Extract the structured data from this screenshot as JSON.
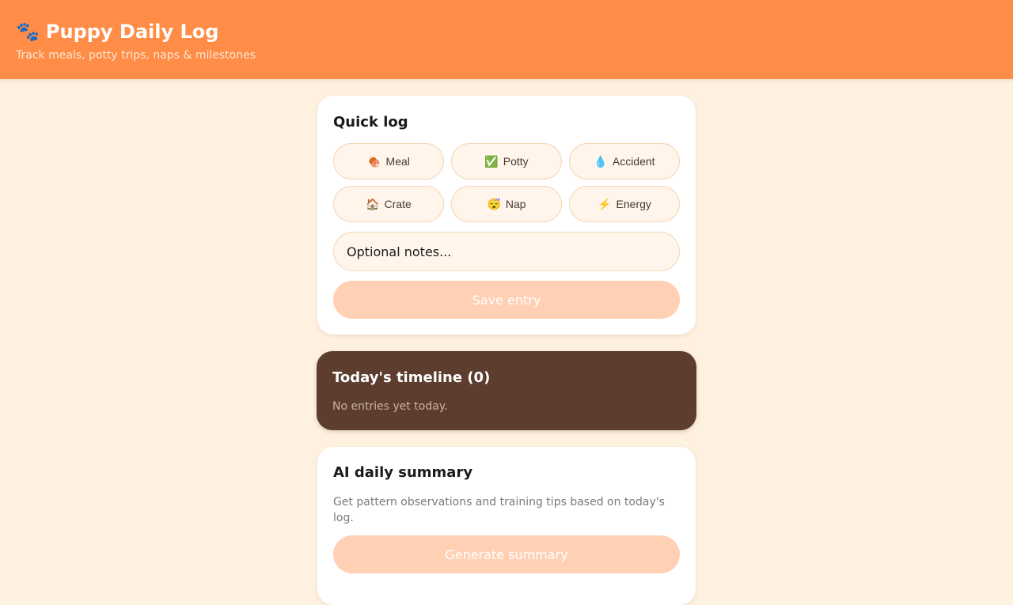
{
  "header": {
    "icon": "🐾",
    "title": "Puppy Daily Log",
    "subtitle": "Track meals, potty trips, naps & milestones"
  },
  "quick_log": {
    "title": "Quick log",
    "buttons": [
      {
        "icon": "🍖",
        "label": "Meal"
      },
      {
        "icon": "✅",
        "label": "Potty"
      },
      {
        "icon": "💧",
        "label": "Accident"
      },
      {
        "icon": "🏠",
        "label": "Crate"
      },
      {
        "icon": "😴",
        "label": "Nap"
      },
      {
        "icon": "⚡",
        "label": "Energy"
      }
    ],
    "notes_placeholder": "Optional notes...",
    "save_label": "Save entry"
  },
  "timeline": {
    "title": "Today's timeline (0)",
    "empty_text": "No entries yet today."
  },
  "summary": {
    "title": "AI daily summary",
    "description": "Get pattern observations and training tips based on today's log.",
    "button_label": "Generate summary"
  },
  "colors": {
    "header": "#FF8C47",
    "background": "#FFF1E0",
    "timeline": "#5C3D2E",
    "button_disabled": "#FFD0B4"
  }
}
